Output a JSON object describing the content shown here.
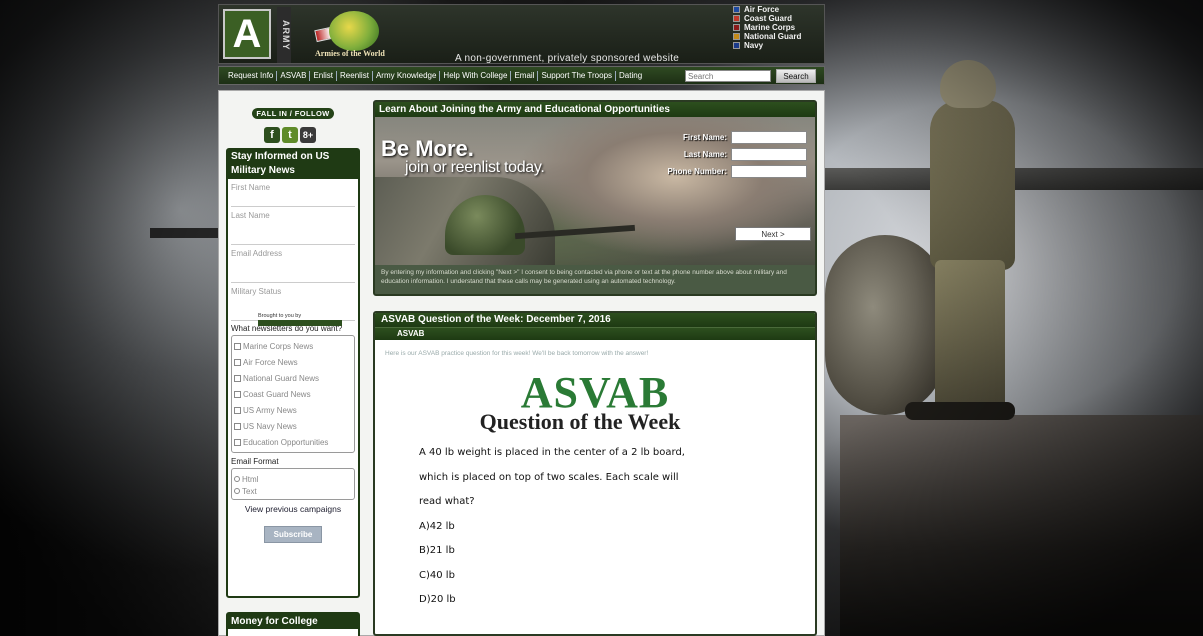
{
  "header": {
    "logo_letter": "A",
    "logo_side": "ARMY",
    "globe_label": "Armies of the World",
    "tagline": "A non-government, privately sponsored website",
    "branches": [
      {
        "label": "Air Force",
        "color": "#1e4aa0"
      },
      {
        "label": "Coast Guard",
        "color": "#c0392b"
      },
      {
        "label": "Marine Corps",
        "color": "#8b1a1a"
      },
      {
        "label": "National Guard",
        "color": "#c48a1a"
      },
      {
        "label": "Navy",
        "color": "#1a3a8a"
      }
    ]
  },
  "nav": {
    "items": [
      "Request Info",
      "ASVAB",
      "Enlist",
      "Reenlist",
      "Army Knowledge",
      "Help With College",
      "Email",
      "Support The Troops",
      "Dating"
    ],
    "search_placeholder": "Search",
    "search_button": "Search"
  },
  "sidebar": {
    "fall_in": "FALL IN / FOLLOW",
    "social": [
      "f",
      "t",
      "8+"
    ],
    "news_title": "Stay Informed on US",
    "news_subtitle": "Military News",
    "fields": [
      "First Name",
      "Last Name",
      "Email Address",
      "Military Status"
    ],
    "newsletters_label": "What newsletters do you want?",
    "newsletters": [
      "Marine Corps News",
      "Air Force News",
      "National Guard News",
      "Coast Guard News",
      "US Army News",
      "US Navy News",
      "Education Opportunities"
    ],
    "format_label": "Email Format",
    "formats": [
      "Html",
      "Text"
    ],
    "previous_link": "View previous campaigns",
    "subscribe_button": "Subscribe",
    "money_title": "Money for College"
  },
  "learn": {
    "title": "Learn About Joining the Army and Educational Opportunities",
    "headline": "Be More.",
    "subheadline": "join or reenlist today.",
    "form_labels": [
      "First Name:",
      "Last Name:",
      "Phone Number:"
    ],
    "next_button": "Next >",
    "disclaimer": "By entering my information and clicking \"Next >\" I consent to being contacted via phone or text at the phone number above about military and education information. I understand that these calls may be generated using an automated technology."
  },
  "asvab": {
    "title": "ASVAB Question of the Week: December 7, 2016",
    "category": "ASVAB",
    "intro": "Here is our ASVAB practice question for this week! We'll be back tomorrow with the answer!",
    "logo": "ASVAB",
    "subtitle": "Question of the Week",
    "question_lines": [
      "A 40 lb weight is placed in the center of a 2 lb board,",
      "which is placed on top of two scales. Each scale will",
      "read what?"
    ],
    "answers": [
      "A)42 lb",
      "B)21 lb",
      "C)40 lb",
      "D)20 lb"
    ],
    "brought_by": "Brought to you by"
  }
}
